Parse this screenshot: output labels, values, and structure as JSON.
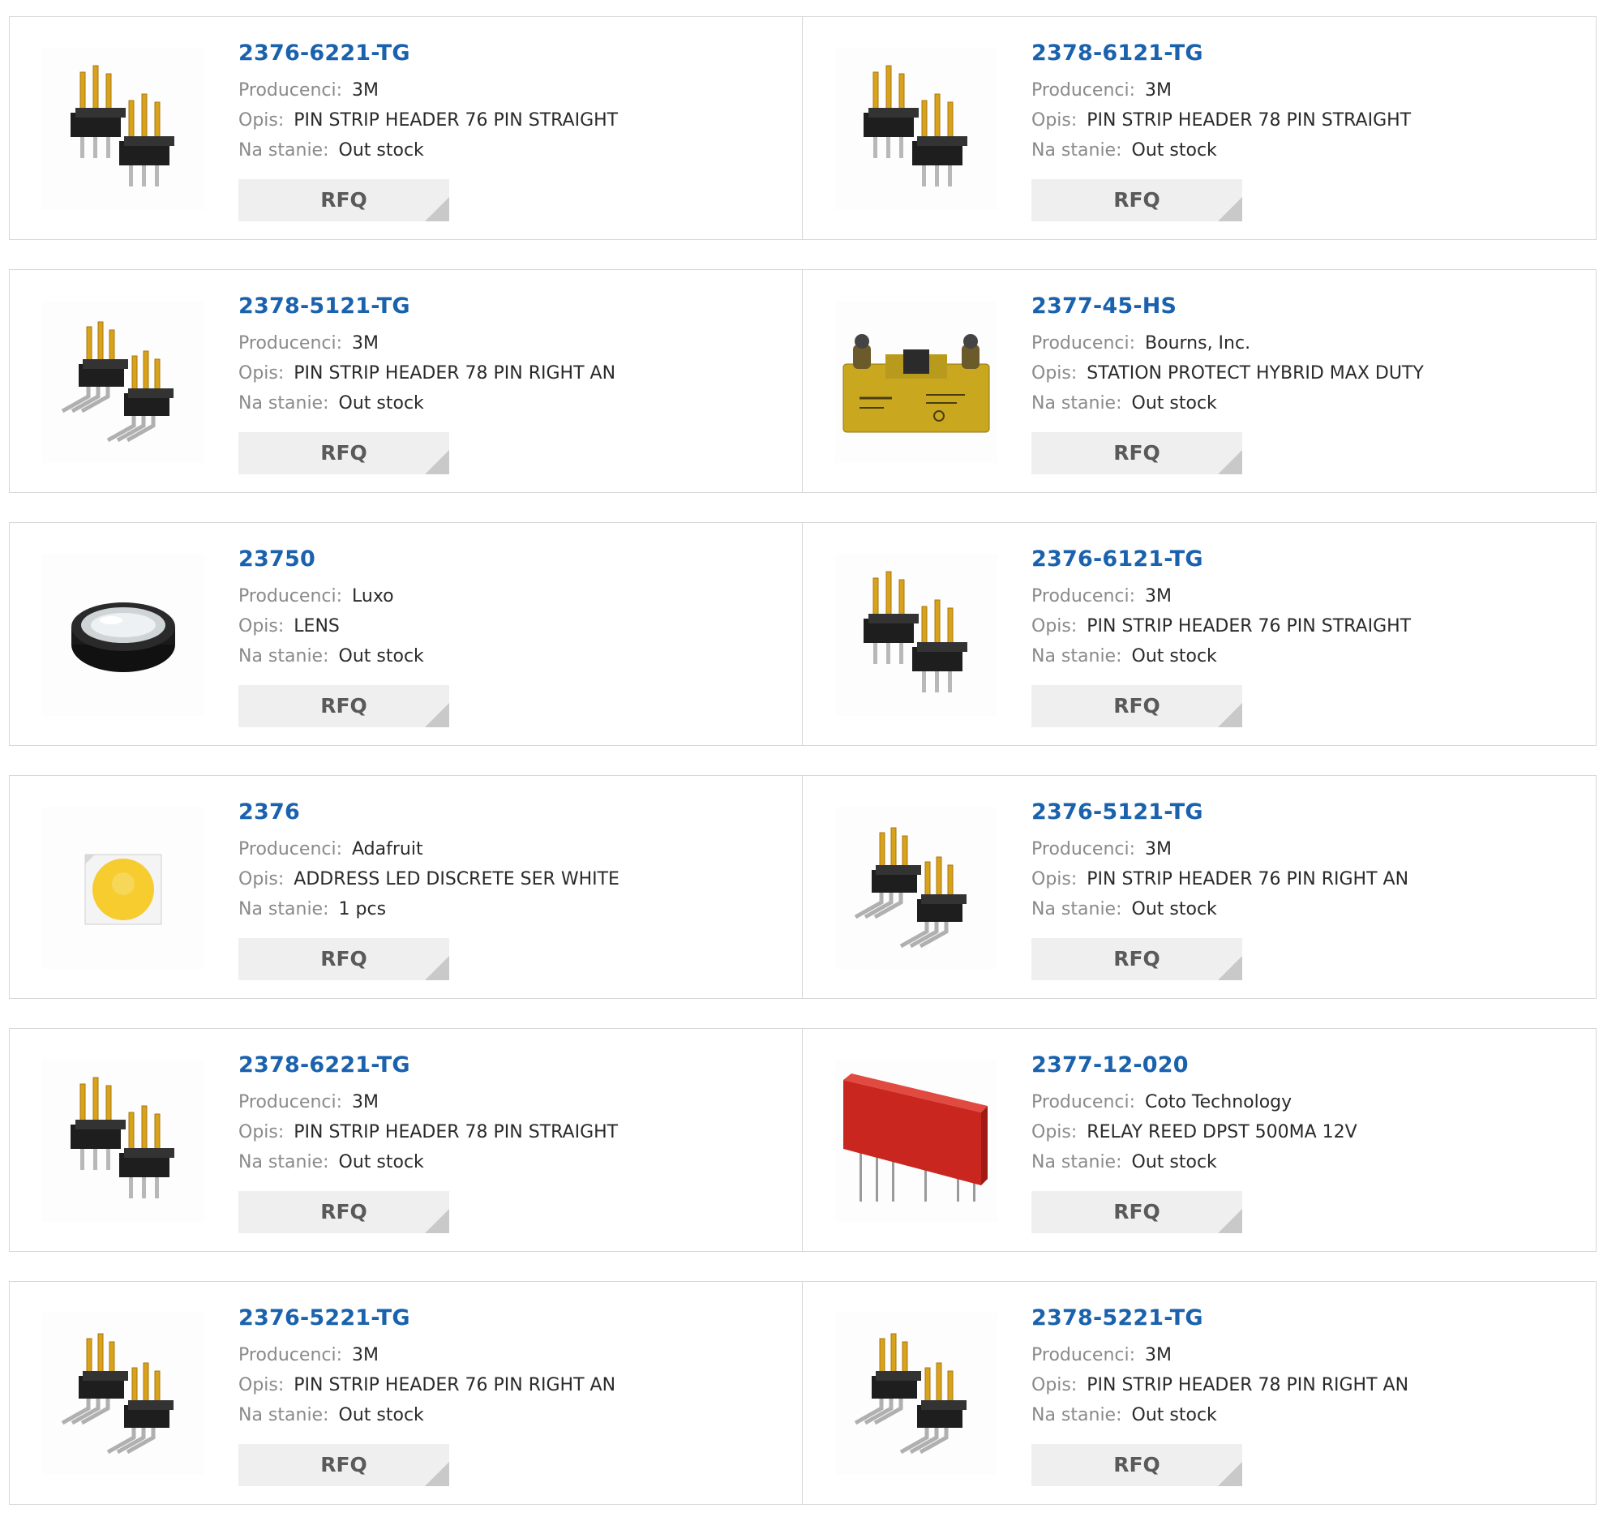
{
  "labels": {
    "manufacturer": "Producenci:",
    "description": "Opis:",
    "stock": "Na stanie:",
    "rfq": "RFQ"
  },
  "colors": {
    "part_link": "#1a62ad",
    "label_text": "#8a8a8a",
    "value_text": "#2a2a2a",
    "rfq_bg": "#efefef",
    "border": "#d7d7d7"
  },
  "products": [
    {
      "part": "2376-6221-TG",
      "manufacturer": "3M",
      "description": "PIN STRIP HEADER 76 PIN STRAIGHT",
      "stock": "Out stock",
      "image_icon": "pin-header-straight-icon"
    },
    {
      "part": "2378-6121-TG",
      "manufacturer": "3M",
      "description": "PIN STRIP HEADER 78 PIN STRAIGHT",
      "stock": "Out stock",
      "image_icon": "pin-header-straight-icon"
    },
    {
      "part": "2378-5121-TG",
      "manufacturer": "3M",
      "description": "PIN STRIP HEADER 78 PIN RIGHT AN",
      "stock": "Out stock",
      "image_icon": "pin-header-right-angle-icon"
    },
    {
      "part": "2377-45-HS",
      "manufacturer": "Bourns, Inc.",
      "description": "STATION PROTECT HYBRID MAX DUTY",
      "stock": "Out stock",
      "image_icon": "station-protector-icon"
    },
    {
      "part": "23750",
      "manufacturer": "Luxo",
      "description": "LENS",
      "stock": "Out stock",
      "image_icon": "lens-icon"
    },
    {
      "part": "2376-6121-TG",
      "manufacturer": "3M",
      "description": "PIN STRIP HEADER 76 PIN STRAIGHT",
      "stock": "Out stock",
      "image_icon": "pin-header-straight-icon"
    },
    {
      "part": "2376",
      "manufacturer": "Adafruit",
      "description": "ADDRESS LED DISCRETE SER WHITE",
      "stock": "1 pcs",
      "image_icon": "led-icon"
    },
    {
      "part": "2376-5121-TG",
      "manufacturer": "3M",
      "description": "PIN STRIP HEADER 76 PIN RIGHT AN",
      "stock": "Out stock",
      "image_icon": "pin-header-right-angle-icon"
    },
    {
      "part": "2378-6221-TG",
      "manufacturer": "3M",
      "description": "PIN STRIP HEADER 78 PIN STRAIGHT",
      "stock": "Out stock",
      "image_icon": "pin-header-straight-icon"
    },
    {
      "part": "2377-12-020",
      "manufacturer": "Coto Technology",
      "description": "RELAY REED DPST 500MA 12V",
      "stock": "Out stock",
      "image_icon": "reed-relay-icon"
    },
    {
      "part": "2376-5221-TG",
      "manufacturer": "3M",
      "description": "PIN STRIP HEADER 76 PIN RIGHT AN",
      "stock": "Out stock",
      "image_icon": "pin-header-right-angle-icon"
    },
    {
      "part": "2378-5221-TG",
      "manufacturer": "3M",
      "description": "PIN STRIP HEADER 78 PIN RIGHT AN",
      "stock": "Out stock",
      "image_icon": "pin-header-right-angle-icon"
    }
  ]
}
